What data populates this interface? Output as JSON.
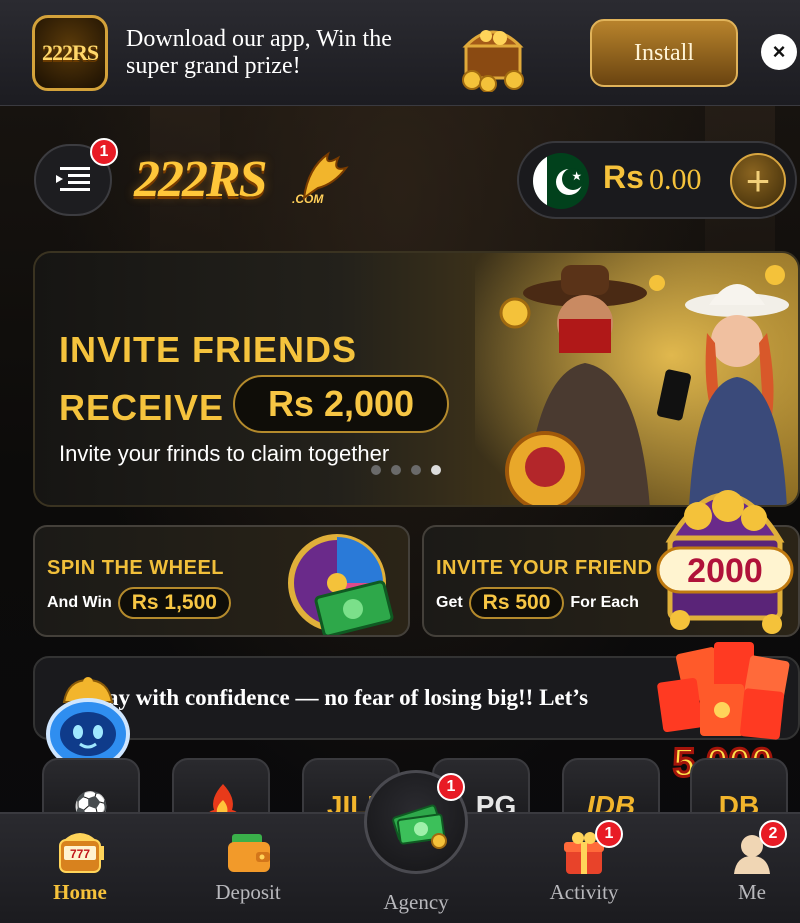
{
  "download_banner": {
    "app_logo_text": "222RS",
    "message": "Download our app, Win the super grand prize!",
    "install_label": "Install",
    "close_symbol": "×"
  },
  "header": {
    "menu_badge": "1",
    "brand": "222RS",
    "brand_suffix": ".COM",
    "balance_currency": "Rs",
    "balance_value": "0.00",
    "add_symbol": "+"
  },
  "hero": {
    "line1": "INVITE FRIENDS",
    "line2": "RECEIVE",
    "amount": "Rs 2,000",
    "subtitle": "Invite your frinds to claim together",
    "slide_count": 4,
    "active_slide": 4
  },
  "promos": [
    {
      "title": "SPIN THE WHEEL",
      "prefix": "And Win",
      "amount": "Rs 1,500",
      "suffix": ""
    },
    {
      "title": "INVITE YOUR FRIEND",
      "prefix": "Get",
      "amount": "Rs 500",
      "suffix": "For Each"
    }
  ],
  "floating": {
    "chest_amount": "2000",
    "red_packet_amount": "5,000"
  },
  "marquee": {
    "text": "ay with confidence — no fear of losing big!! Let’s"
  },
  "game_tiles": [
    {
      "name": "sports",
      "label": "⚽"
    },
    {
      "name": "hot",
      "label": ""
    },
    {
      "name": "jili",
      "label": "JILI"
    },
    {
      "name": "pg",
      "label": "PG"
    },
    {
      "name": "idb",
      "label": "IDB"
    },
    {
      "name": "db",
      "label": "DB"
    }
  ],
  "bottom_nav": [
    {
      "id": "home",
      "label": "Home",
      "active": true,
      "badge": ""
    },
    {
      "id": "deposit",
      "label": "Deposit",
      "active": false,
      "badge": ""
    },
    {
      "id": "agency",
      "label": "Agency",
      "active": false,
      "badge": "1"
    },
    {
      "id": "activity",
      "label": "Activity",
      "active": false,
      "badge": "1"
    },
    {
      "id": "me",
      "label": "Me",
      "active": false,
      "badge": "2"
    }
  ],
  "colors": {
    "gold": "#f6c23b",
    "badge_red": "#e81b25",
    "background": "#0b0b0d"
  }
}
